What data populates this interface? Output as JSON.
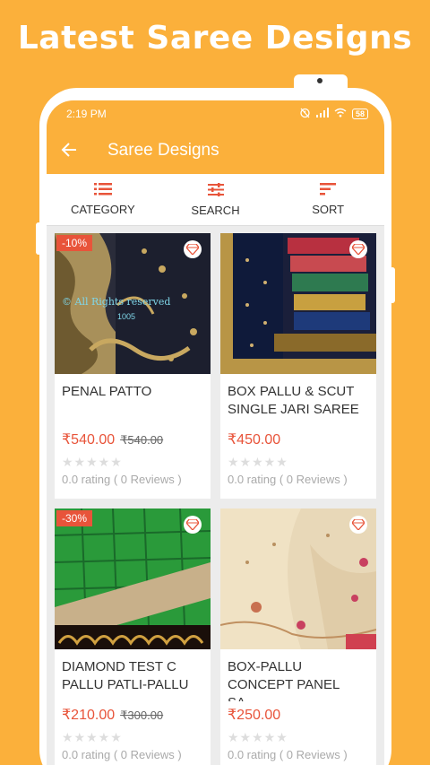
{
  "promo": {
    "title": "Latest Saree Designs"
  },
  "status_bar": {
    "time": "2:19 PM",
    "battery": "58"
  },
  "app_bar": {
    "title": "Saree Designs"
  },
  "toolbar": {
    "category": "CATEGORY",
    "search": "SEARCH",
    "sort": "SORT"
  },
  "products": [
    {
      "title": "PENAL PATTO",
      "price": "₹540.00",
      "old_price": "₹540.00",
      "discount": "-10%",
      "rating": "0.0 rating ( 0 Reviews )",
      "stars": "★★★★★",
      "watermark": "© All Rights reserved",
      "watermark_code": "1005"
    },
    {
      "title": "BOX PALLU  &  SCUT SINGLE JARI SAREE",
      "price": "₹450.00",
      "old_price": "",
      "discount": "",
      "rating": "0.0 rating ( 0 Reviews )",
      "stars": "★★★★★"
    },
    {
      "title": "DIAMOND TEST C PALLU PATLI-PALLU ...",
      "price": "₹210.00",
      "old_price": "₹300.00",
      "discount": "-30%",
      "rating": "0.0 rating ( 0 Reviews )",
      "stars": "★★★★★"
    },
    {
      "title": "BOX-PALLU CONCEPT PANEL SA...",
      "price": "₹250.00",
      "old_price": "",
      "discount": "",
      "rating": "0.0 rating ( 0 Reviews )",
      "stars": "★★★★★"
    }
  ],
  "colors": {
    "accent": "#fbb03b",
    "price": "#e8543a"
  }
}
